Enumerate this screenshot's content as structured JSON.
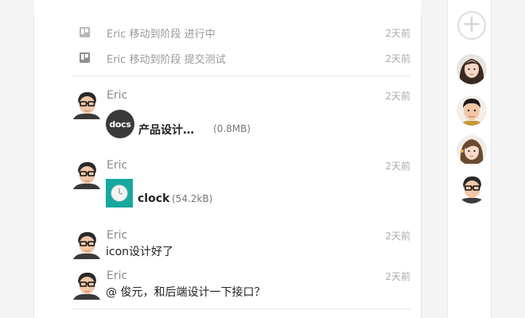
{
  "activities": [
    {
      "text": "Eric 移动到阶段 进行中",
      "time": "2天前",
      "icon": "board-icon"
    },
    {
      "text": "Eric 移动到阶段 提交测试",
      "time": "2天前",
      "icon": "board-icon"
    }
  ],
  "messages": [
    {
      "author": "Eric",
      "time": "2天前",
      "attachment": {
        "icon_label": "docs",
        "name": "产品设计…",
        "size": "(0.8MB)"
      }
    },
    {
      "author": "Eric",
      "time": "2天前",
      "attachment": {
        "icon": "clock-icon",
        "name": "clock",
        "size": "(54.2kB)"
      }
    },
    {
      "author": "Eric",
      "time": "2天前",
      "text": "icon设计好了"
    },
    {
      "author": "Eric",
      "time": "2天前",
      "text": "@ 俊元，和后端设计一下接口？"
    }
  ],
  "sidebar": {
    "add_icon": "plus-icon",
    "members": [
      "member-avatar-girl-1",
      "member-avatar-boy",
      "member-avatar-girl-2",
      "member-avatar-eric"
    ]
  },
  "colors": {
    "background": "#f4f4f5",
    "panel": "#ffffff",
    "divider": "#e6e6e6",
    "muted_text": "#999999",
    "clock_thumb": "#17a89e",
    "docs_icon": "#3a3a3a"
  }
}
